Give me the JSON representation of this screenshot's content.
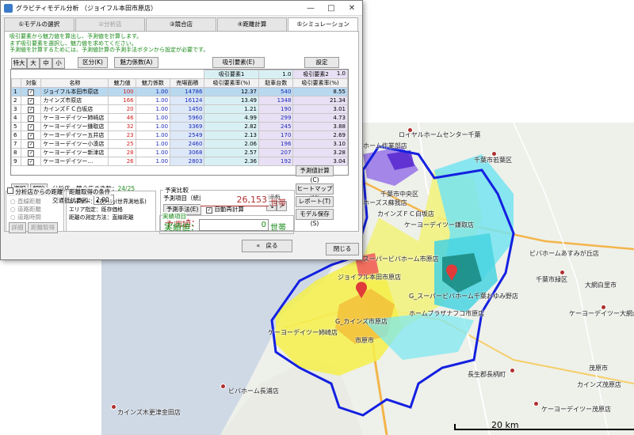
{
  "window": {
    "title": "グラビティモデル分析 （ジョイフル本田市原店）",
    "controls": [
      "—",
      "□",
      "✕"
    ]
  },
  "tabs": [
    {
      "label": "①モデルの選択",
      "state": "normal"
    },
    {
      "label": "②分析店",
      "state": "disabled"
    },
    {
      "label": "③競合店",
      "state": "normal"
    },
    {
      "label": "④距離計算",
      "state": "normal"
    },
    {
      "label": "⑤シミュレーション",
      "state": "active"
    }
  ],
  "message": {
    "line1": "吸引要素から魅力値を算出し、予測値を計算します。",
    "line2": "まず吸引要素を選択し、魅力値を求めてください。",
    "line3": "予測値を計算するためには、予測値計算の予測手法ボタンから設定が必要です。"
  },
  "size_buttons": [
    "特大",
    "大",
    "中",
    "小"
  ],
  "toolbar": {
    "division": "区分(K)",
    "attraction_coef": "魅力係数(A)",
    "attract_elem": "吸引要素(E)",
    "settings": "設定"
  },
  "grid": {
    "group_header1": "吸引要素1",
    "group_header2": "吸引要素2",
    "group_val1": "1.0",
    "group_val2": "1.0",
    "columns": [
      "",
      "対象",
      "名称",
      "魅力値",
      "魅力係数",
      "売場面積",
      "吸引要素率(%)",
      "駐車台数",
      "吸引要素率(%)"
    ],
    "rows": [
      {
        "no": "1",
        "checked": true,
        "name": "ジョイフル本田市原店",
        "attract": "100",
        "coef": "1.00",
        "area": "14786",
        "rate1": "12.37",
        "parking": "540",
        "rate2": "8.55",
        "selected": true
      },
      {
        "no": "2",
        "checked": true,
        "name": "カインズ市原店",
        "attract": "166",
        "coef": "1.00",
        "area": "16124",
        "rate1": "13.49",
        "parking": "1348",
        "rate2": "21.34"
      },
      {
        "no": "3",
        "checked": true,
        "name": "カインズＦＣ白坂店",
        "attract": "20",
        "coef": "1.00",
        "area": "1450",
        "rate1": "1.21",
        "parking": "190",
        "rate2": "3.01"
      },
      {
        "no": "4",
        "checked": true,
        "name": "ケーヨーデイツー姉崎店",
        "attract": "46",
        "coef": "1.00",
        "area": "5960",
        "rate1": "4.99",
        "parking": "299",
        "rate2": "4.73"
      },
      {
        "no": "5",
        "checked": true,
        "name": "ケーヨーデイツー鎌取店",
        "attract": "32",
        "coef": "1.00",
        "area": "3369",
        "rate1": "2.82",
        "parking": "245",
        "rate2": "3.88"
      },
      {
        "no": "6",
        "checked": true,
        "name": "ケーヨーデイツー五井店",
        "attract": "23",
        "coef": "1.00",
        "area": "2549",
        "rate1": "2.13",
        "parking": "170",
        "rate2": "2.69"
      },
      {
        "no": "7",
        "checked": true,
        "name": "ケーヨーデイツー小湊店",
        "attract": "25",
        "coef": "1.00",
        "area": "2460",
        "rate1": "2.06",
        "parking": "196",
        "rate2": "3.10"
      },
      {
        "no": "8",
        "checked": true,
        "name": "ケーヨーデイツー新津店",
        "attract": "28",
        "coef": "1.00",
        "area": "3068",
        "rate1": "2.57",
        "parking": "207",
        "rate2": "3.28"
      },
      {
        "no": "9",
        "checked": true,
        "name": "ケーヨーデイツー…",
        "attract": "26",
        "coef": "1.00",
        "area": "2803",
        "rate1": "2.36",
        "parking": "192",
        "rate2": "3.04"
      }
    ]
  },
  "bottom": {
    "select_btn": "選択",
    "release_btn": "解除",
    "count_label": "分析店・競合店の件数：",
    "count_value": "24/25",
    "resist_label": "交通抵抗要因：",
    "resist_value": "2.00"
  },
  "distance_group": {
    "title": "分析店からの距離",
    "options": [
      "直線距離",
      "道路距離",
      "道路時間"
    ],
    "detail_btn": "詳細",
    "recalc_btn": "距離取得"
  },
  "condition_group": {
    "title": "距離取得の条件",
    "layer": "レイヤー：4次ﾒｯｼｭ(世界測地系)",
    "area": "エリア指定：既存価格",
    "method": "距離の測定方法：直線距離"
  },
  "forecast": {
    "group_title": "予実比較",
    "item_title": "予測項目（統計データの集計値）",
    "method_btn": "予測手法(E)",
    "auto_label": "自動再計算",
    "display_label": "表示桁",
    "pred_label": "予測値：",
    "pred_value": "26,153",
    "pred_unit": "世帯",
    "actual_group": "実績項目",
    "actual_label": "実績値：",
    "actual_value": "0",
    "actual_unit": "世帯"
  },
  "right_buttons": [
    "予測値計算(C)",
    "ヒートマップ(M)",
    "レポート(T)",
    "モデル保存(S)"
  ],
  "nav": {
    "back": "«　戻る",
    "close": "閉じる"
  },
  "map": {
    "labels": [
      {
        "text": "ロイヤルホームセンター千葉"
      },
      {
        "text": "ホーム作業部店"
      },
      {
        "text": "千葉市若葉区"
      },
      {
        "text": "千葉市中央区"
      },
      {
        "text": "ホーズス蘇我店"
      },
      {
        "text": "カインズＦＣ白坂店"
      },
      {
        "text": "ケーヨーデイツー鎌取店"
      },
      {
        "text": "ビバホームあすみが丘店"
      },
      {
        "text": "スーパービバホーム市原店"
      },
      {
        "text": "ジョイフル本田市原店"
      },
      {
        "text": "G_スーパービバホーム千葉おゆみ野店"
      },
      {
        "text": "千葉市緑区"
      },
      {
        "text": "大網白里市"
      },
      {
        "text": "G_カインズ市原店"
      },
      {
        "text": "ホームプラザナフコ市原店"
      },
      {
        "text": "ケーヨーデイツー大網永田店"
      },
      {
        "text": "ケーヨーデイツー姉崎店"
      },
      {
        "text": "市原市"
      },
      {
        "text": "長生郡長柄町"
      },
      {
        "text": "茂原市"
      },
      {
        "text": "ビバホーム長浦店"
      },
      {
        "text": "カインズ茂原店"
      },
      {
        "text": "カインズ木更津金田店"
      },
      {
        "text": "ケーヨーデイツー茂原店"
      }
    ],
    "scale": "20 km"
  }
}
